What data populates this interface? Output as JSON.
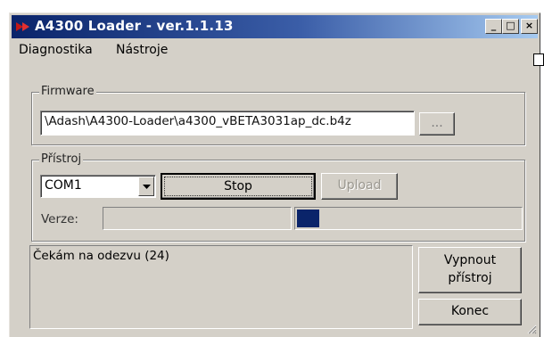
{
  "window": {
    "title": "A4300 Loader - ver.1.1.13",
    "minimize": "_",
    "maximize": "□",
    "close": "×"
  },
  "menu": {
    "items": [
      "Diagnostika",
      "Nástroje"
    ]
  },
  "firmware": {
    "label": "Firmware",
    "path": "\\Adash\\A4300-Loader\\a4300_vBETA3031ap_dc.b4z",
    "browse": "..."
  },
  "device": {
    "label": "Přístroj",
    "port": "COM1",
    "stop": "Stop",
    "upload": "Upload",
    "version_label": "Verze:",
    "progress": 0.1
  },
  "status": {
    "message": "Čekám na odezvu  (24)"
  },
  "buttons": {
    "power_off": "Vypnout přístroj",
    "exit": "Konec"
  },
  "colors": {
    "title_bar": "#0a246a",
    "progress_fill": "#0a246a"
  }
}
